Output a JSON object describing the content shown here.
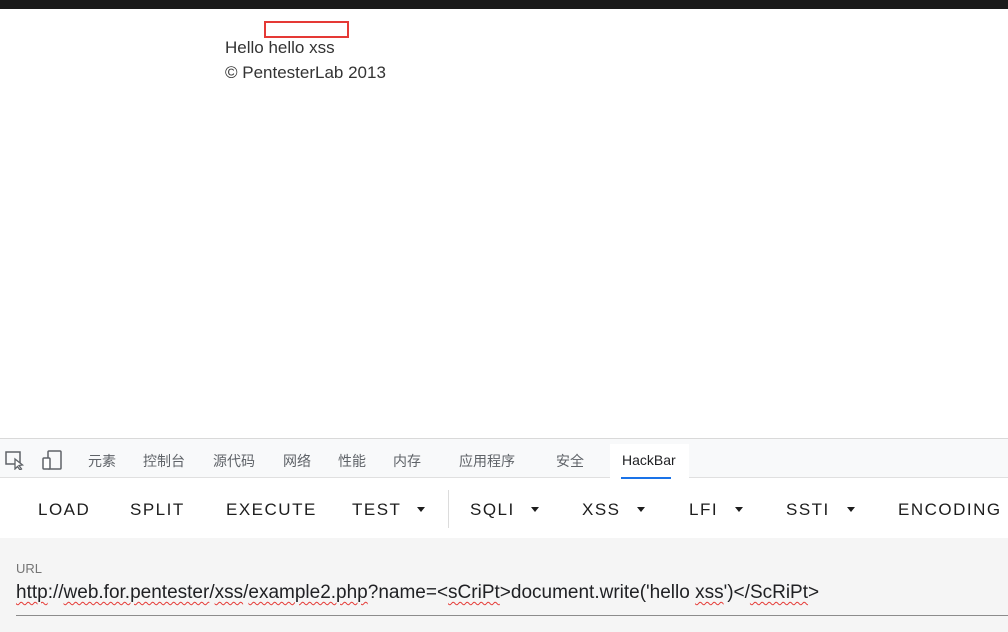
{
  "page": {
    "line1": "Hello hello xss",
    "line2": "© PentesterLab 2013"
  },
  "devtools": {
    "tabs": [
      "元素",
      "控制台",
      "源代码",
      "网络",
      "性能",
      "内存",
      "应用程序",
      "安全"
    ],
    "active_tab": "HackBar",
    "icons": [
      "inspect-element-icon",
      "device-toolbar-icon"
    ]
  },
  "hackbar": {
    "buttons": {
      "load": "LOAD",
      "split": "SPLIT",
      "execute": "EXECUTE",
      "test": "TEST",
      "sqli": "SQLI",
      "xss": "XSS",
      "lfi": "LFI",
      "ssti": "SSTI",
      "encoding": "ENCODING"
    },
    "url_label": "URL",
    "url": {
      "p1": "http",
      "p2": "://",
      "p3": "web.for.pentester",
      "p4": "/",
      "p5": "xss",
      "p6": "/",
      "p7": "example2.php",
      "p8": "?name=<",
      "p9": "sCriPt",
      "p10": ">document.write('hello ",
      "p11": "xss",
      "p12": "')</",
      "p13": "ScRiPt",
      "p14": ">"
    }
  },
  "colors": {
    "highlight": "#e53935",
    "active_tab_underline": "#1a73e8"
  }
}
